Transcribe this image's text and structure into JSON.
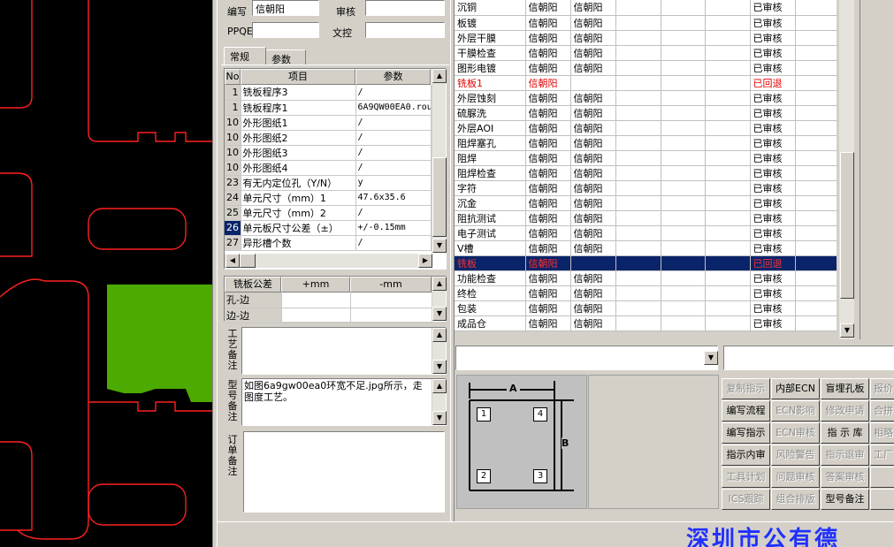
{
  "header": {
    "author_label": "编写",
    "author_value": "信朝阳",
    "review_label": "审核",
    "review_value": "",
    "ppqe_label": "PPQE",
    "ppqe_value": "",
    "doc_label": "文控",
    "doc_value": ""
  },
  "tabs": [
    {
      "label": "常规"
    },
    {
      "label": "参数"
    }
  ],
  "params": {
    "headers": [
      "No",
      "项目",
      "参数"
    ],
    "rows": [
      {
        "no": "1",
        "item": "铣板程序3",
        "value": "/"
      },
      {
        "no": "1",
        "item": "铣板程序1",
        "value": "6A9QW00EA0.rou"
      },
      {
        "no": "10",
        "item": "外形图纸1",
        "value": "/"
      },
      {
        "no": "10",
        "item": "外形图纸2",
        "value": "/"
      },
      {
        "no": "10",
        "item": "外形图纸3",
        "value": "/"
      },
      {
        "no": "10",
        "item": "外形图纸4",
        "value": "/"
      },
      {
        "no": "23",
        "item": "有无内定位孔（Y/N）",
        "value": "y"
      },
      {
        "no": "24",
        "item": "单元尺寸（mm）1",
        "value": "47.6x35.6"
      },
      {
        "no": "25",
        "item": "单元尺寸（mm）2",
        "value": "/"
      },
      {
        "no": "26",
        "item": "单元板尺寸公差（±）",
        "value": "+/-0.15mm"
      },
      {
        "no": "27",
        "item": "异形槽个数",
        "value": "/"
      }
    ]
  },
  "tolerance": {
    "headers": [
      "铣板公差",
      "+mm",
      "-mm"
    ],
    "rows": [
      {
        "name": "孔-边"
      },
      {
        "name": "边-边"
      }
    ]
  },
  "notes": {
    "craft_label": "工艺备注",
    "model_label": "型号备注",
    "model_text": "如图6a9gw00ea0环宽不足.jpg所示，走图度工艺。",
    "order_label": "订单备注"
  },
  "process": {
    "rows": [
      {
        "step": "沉铜",
        "a": "信朝阳",
        "b": "信朝阳",
        "status": "已审核"
      },
      {
        "step": "板镀",
        "a": "信朝阳",
        "b": "信朝阳",
        "status": "已审核"
      },
      {
        "step": "外层干膜",
        "a": "信朝阳",
        "b": "信朝阳",
        "status": "已审核"
      },
      {
        "step": "干膜检查",
        "a": "信朝阳",
        "b": "信朝阳",
        "status": "已审核"
      },
      {
        "step": "图形电镀",
        "a": "信朝阳",
        "b": "信朝阳",
        "status": "已审核"
      },
      {
        "step": "铣板1",
        "a": "信朝阳",
        "b": "",
        "status": "已回退",
        "state": "red"
      },
      {
        "step": "外层蚀刻",
        "a": "信朝阳",
        "b": "信朝阳",
        "status": "已审核"
      },
      {
        "step": "硫脲洗",
        "a": "信朝阳",
        "b": "信朝阳",
        "status": "已审核"
      },
      {
        "step": "外层AOI",
        "a": "信朝阳",
        "b": "信朝阳",
        "status": "已审核"
      },
      {
        "step": "阻焊塞孔",
        "a": "信朝阳",
        "b": "信朝阳",
        "status": "已审核"
      },
      {
        "step": "阻焊",
        "a": "信朝阳",
        "b": "信朝阳",
        "status": "已审核"
      },
      {
        "step": "阻焊检查",
        "a": "信朝阳",
        "b": "信朝阳",
        "status": "已审核"
      },
      {
        "step": "字符",
        "a": "信朝阳",
        "b": "信朝阳",
        "status": "已审核"
      },
      {
        "step": "沉金",
        "a": "信朝阳",
        "b": "信朝阳",
        "status": "已审核"
      },
      {
        "step": "阻抗测试",
        "a": "信朝阳",
        "b": "信朝阳",
        "status": "已审核"
      },
      {
        "step": "电子测试",
        "a": "信朝阳",
        "b": "信朝阳",
        "status": "已审核"
      },
      {
        "step": "V槽",
        "a": "信朝阳",
        "b": "信朝阳",
        "status": "已审核"
      },
      {
        "step": "铣板",
        "a": "信朝阳",
        "b": "",
        "status": "已回退",
        "state": "sel"
      },
      {
        "step": "功能检查",
        "a": "信朝阳",
        "b": "信朝阳",
        "status": "已审核"
      },
      {
        "step": "终检",
        "a": "信朝阳",
        "b": "信朝阳",
        "status": "已审核"
      },
      {
        "step": "包装",
        "a": "信朝阳",
        "b": "信朝阳",
        "status": "已审核"
      },
      {
        "step": "成品仓",
        "a": "信朝阳",
        "b": "信朝阳",
        "status": "已审核"
      }
    ]
  },
  "diagram": {
    "label_a": "A",
    "label_b": "B",
    "n1": "1",
    "n2": "2",
    "n3": "3",
    "n4": "4"
  },
  "buttons": [
    {
      "label": "复制指示",
      "enabled": false
    },
    {
      "label": "内部ECN",
      "enabled": true
    },
    {
      "label": "盲埋孔板",
      "enabled": true
    },
    {
      "label": "报价",
      "enabled": false
    },
    {
      "label": "编写流程",
      "enabled": true
    },
    {
      "label": "ECN影响",
      "enabled": false
    },
    {
      "label": "修改申请",
      "enabled": false
    },
    {
      "label": "合拼",
      "enabled": false
    },
    {
      "label": "编写指示",
      "enabled": true
    },
    {
      "label": "ECN审核",
      "enabled": false
    },
    {
      "label": "指 示 库",
      "enabled": true
    },
    {
      "label": "相略",
      "enabled": false
    },
    {
      "label": "指示内审",
      "enabled": true
    },
    {
      "label": "风险警告",
      "enabled": false
    },
    {
      "label": "指示退审",
      "enabled": false
    },
    {
      "label": "工厂",
      "enabled": false
    },
    {
      "label": "工具计划",
      "enabled": false
    },
    {
      "label": "问题审核",
      "enabled": false
    },
    {
      "label": "答案审核",
      "enabled": false
    },
    {
      "label": "",
      "enabled": false
    },
    {
      "label": "ICS跟踪",
      "enabled": false
    },
    {
      "label": "组合排版",
      "enabled": false
    },
    {
      "label": "型号备注",
      "enabled": true
    },
    {
      "label": "",
      "enabled": false
    }
  ],
  "status": {
    "company": "深圳市公有德"
  },
  "colors": {
    "selection": "#0a246a",
    "alert": "#e00000",
    "cad_line": "#ff0000",
    "cad_fill": "#4caa00",
    "company": "#2030ff"
  }
}
